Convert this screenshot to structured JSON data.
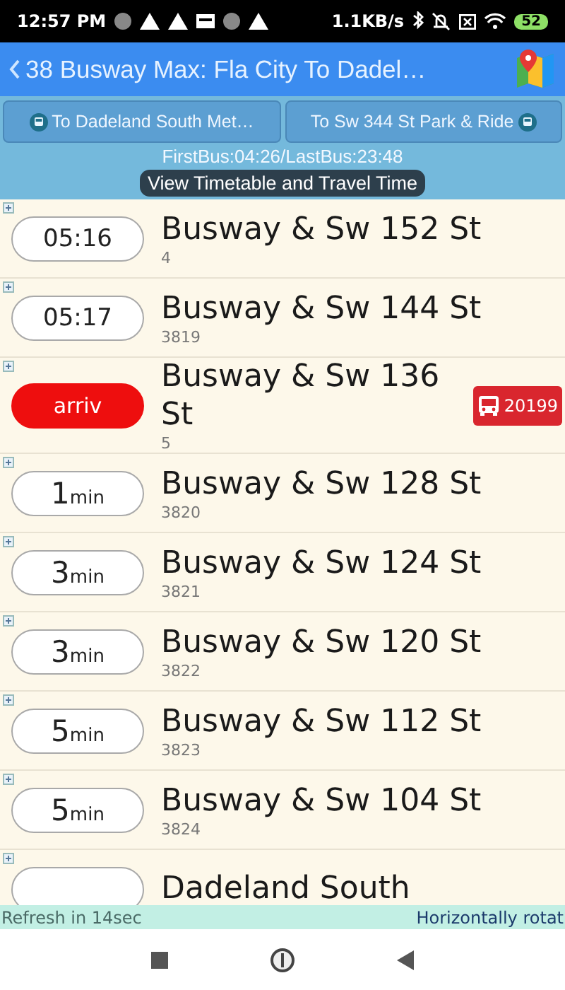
{
  "status_bar": {
    "time": "12:57 PM",
    "speed": "1.1KB/s",
    "battery": "52"
  },
  "header": {
    "title": "38 Busway Max: Fla City To Dadel…"
  },
  "directions": [
    {
      "label": "To Dadeland South Met…",
      "kind": "icon_left"
    },
    {
      "label": "To Sw 344 St Park & Ride",
      "kind": "icon_right"
    }
  ],
  "service_hours": "FirstBus:04:26/LastBus:23:48",
  "timetable_button": "View Timetable and Travel Time",
  "stops": [
    {
      "kind": "time",
      "eta": "05:16",
      "name": "Busway & Sw 152 St",
      "code": "4"
    },
    {
      "kind": "time",
      "eta": "05:17",
      "name": "Busway & Sw 144 St",
      "code": "3819"
    },
    {
      "kind": "arriving",
      "eta": "arriv",
      "name": "Busway & Sw 136 St",
      "code": "5",
      "vehicle": "20199"
    },
    {
      "kind": "minutes",
      "eta": "1",
      "unit": "min",
      "name": "Busway & Sw 128 St",
      "code": "3820"
    },
    {
      "kind": "minutes",
      "eta": "3",
      "unit": "min",
      "name": "Busway & Sw 124 St",
      "code": "3821"
    },
    {
      "kind": "minutes",
      "eta": "3",
      "unit": "min",
      "name": "Busway & Sw 120 St",
      "code": "3822"
    },
    {
      "kind": "minutes",
      "eta": "5",
      "unit": "min",
      "name": "Busway & Sw 112 St",
      "code": "3823"
    },
    {
      "kind": "minutes",
      "eta": "5",
      "unit": "min",
      "name": "Busway & Sw 104 St",
      "code": "3824"
    },
    {
      "kind": "blank",
      "name": "Dadeland South"
    }
  ],
  "footer": {
    "refresh": "Refresh in 14sec",
    "hint": "Horizontally rotat"
  }
}
